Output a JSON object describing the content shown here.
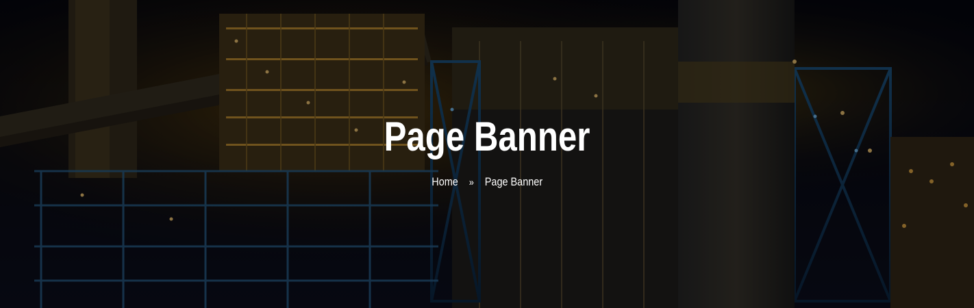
{
  "banner": {
    "title": "Page Banner",
    "overlay_color": "#000000",
    "background_theme": "industrial-plant-night"
  },
  "breadcrumb": {
    "items": [
      {
        "label": "Home",
        "link": true
      },
      {
        "label": "Page Banner",
        "link": false
      }
    ],
    "separator_icon": "double-chevron-right-icon",
    "separator_glyph": "»"
  }
}
